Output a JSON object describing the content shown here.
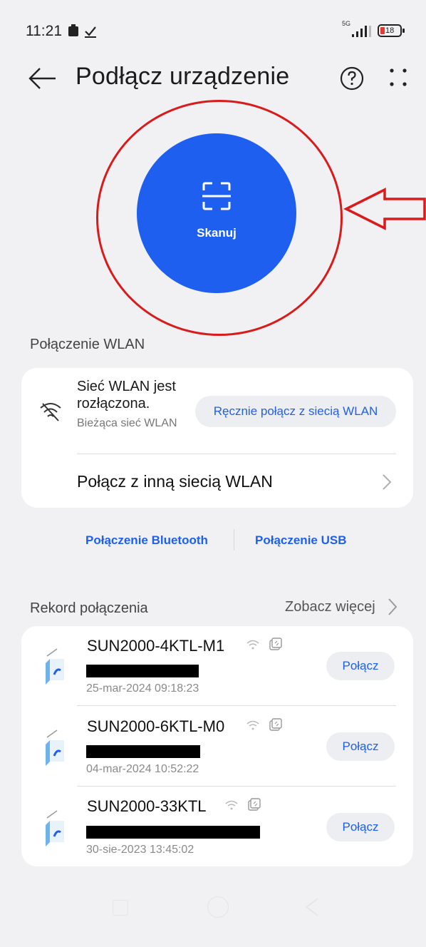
{
  "status_bar": {
    "time": "11:21",
    "network": "5G",
    "battery": "18"
  },
  "header": {
    "title": "Podłącz urządzenie"
  },
  "scan": {
    "label": "Skanuj"
  },
  "wlan": {
    "section_title": "Połączenie WLAN",
    "status": "Sieć WLAN jest rozłączona.",
    "current_network": "Bieżąca sieć WLAN",
    "manual_connect": "Ręcznie połącz z siecią WLAN",
    "other_network": "Połącz z inną siecią WLAN"
  },
  "options": {
    "bluetooth": "Połączenie Bluetooth",
    "usb": "Połączenie USB"
  },
  "records": {
    "section_title": "Rekord połączenia",
    "see_more": "Zobacz więcej",
    "connect_label": "Połącz",
    "items": [
      {
        "name": "SUN2000-4KTL-M1",
        "date": "25-mar-2024 09:18:23"
      },
      {
        "name": "SUN2000-6KTL-M0",
        "date": "04-mar-2024 10:52:22"
      },
      {
        "name": "SUN2000-33KTL",
        "date": "30-sie-2023 13:45:02"
      }
    ]
  },
  "colors": {
    "accent": "#1f5ff0",
    "annotation": "#d81b1b",
    "background": "#f1f1f3"
  }
}
